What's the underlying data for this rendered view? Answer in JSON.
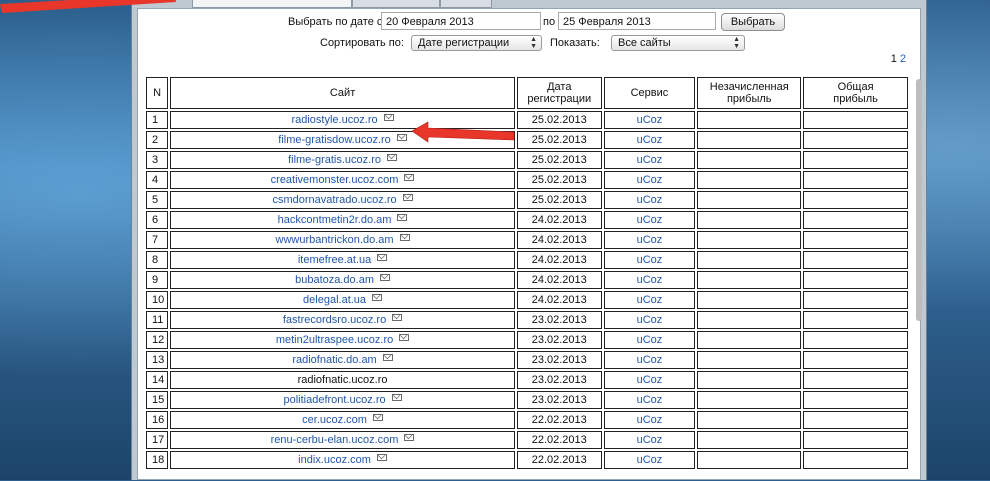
{
  "filter": {
    "date_label": "Выбрать по дате с",
    "date_from": "20 Февраля 2013",
    "to_label": "по",
    "date_to": "25 Февраля 2013",
    "select_button": "Выбрать"
  },
  "sort": {
    "label": "Сортировать по:",
    "value": "Дате регистрации",
    "show_label": "Показать:",
    "show_value": "Все сайты"
  },
  "pagination": {
    "pages": [
      "1",
      "2"
    ]
  },
  "table": {
    "headers": {
      "n": "N",
      "site": "Сайт",
      "date_line1": "Дата",
      "date_line2": "регистрации",
      "service": "Сервис",
      "unpaid_line1": "Незачисленная",
      "unpaid_line2": "прибыль",
      "total_line1": "Общая",
      "total_line2": "прибыль"
    },
    "rows": [
      {
        "n": "1",
        "site": "radiostyle.ucoz.ro",
        "date": "25.02.2013",
        "service": "uCoz"
      },
      {
        "n": "2",
        "site": "filme-gratisdow.ucoz.ro",
        "date": "25.02.2013",
        "service": "uCoz"
      },
      {
        "n": "3",
        "site": "filme-gratis.ucoz.ro",
        "date": "25.02.2013",
        "service": "uCoz"
      },
      {
        "n": "4",
        "site": "creativemonster.ucoz.com",
        "date": "25.02.2013",
        "service": "uCoz"
      },
      {
        "n": "5",
        "site": "csmdornavatrado.ucoz.ro",
        "date": "25.02.2013",
        "service": "uCoz"
      },
      {
        "n": "6",
        "site": "hackcontmetin2r.do.am",
        "date": "24.02.2013",
        "service": "uCoz"
      },
      {
        "n": "7",
        "site": "wwwurbantrickon.do.am",
        "date": "24.02.2013",
        "service": "uCoz"
      },
      {
        "n": "8",
        "site": "itemefree.at.ua",
        "date": "24.02.2013",
        "service": "uCoz"
      },
      {
        "n": "9",
        "site": "bubatoza.do.am",
        "date": "24.02.2013",
        "service": "uCoz"
      },
      {
        "n": "10",
        "site": "delegal.at.ua",
        "date": "24.02.2013",
        "service": "uCoz"
      },
      {
        "n": "11",
        "site": "fastrecordsro.ucoz.ro",
        "date": "23.02.2013",
        "service": "uCoz"
      },
      {
        "n": "12",
        "site": "metin2ultraspee.ucoz.ro",
        "date": "23.02.2013",
        "service": "uCoz"
      },
      {
        "n": "13",
        "site": "radiofnatic.do.am",
        "date": "23.02.2013",
        "service": "uCoz"
      },
      {
        "n": "14",
        "site": "radiofnatic.ucoz.ro",
        "date": "23.02.2013",
        "service": "uCoz"
      },
      {
        "n": "15",
        "site": "politiadefront.ucoz.ro",
        "date": "23.02.2013",
        "service": "uCoz"
      },
      {
        "n": "16",
        "site": "cer.ucoz.com",
        "date": "22.02.2013",
        "service": "uCoz"
      },
      {
        "n": "17",
        "site": "renu-cerbu-elan.ucoz.com",
        "date": "22.02.2013",
        "service": "uCoz"
      },
      {
        "n": "18",
        "site": "indix.ucoz.com",
        "date": "22.02.2013",
        "service": "uCoz"
      }
    ]
  },
  "colors": {
    "link": "#2157a8",
    "annotation_arrow": "#e8372a"
  }
}
